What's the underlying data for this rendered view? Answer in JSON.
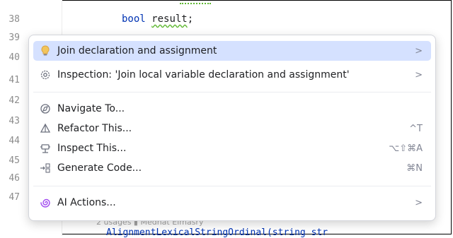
{
  "editor": {
    "line_numbers": [
      "38",
      "39",
      "40",
      "41",
      "42",
      "43",
      "44",
      "45",
      "46",
      "47"
    ],
    "code_line": {
      "keyword": "bool",
      "variable": "result",
      "tail": ";"
    },
    "hint_text": "2 usages  ▮ Medhat Elmasry",
    "bottom_code": "AlignmentLexicalStringOrdinal(string str"
  },
  "popup": {
    "items": [
      {
        "label": "Join declaration and assignment",
        "icon": "lightbulb-icon",
        "submenu": true
      },
      {
        "label": "Inspection: 'Join local variable declaration and assignment'",
        "icon": "inspection-gear-icon",
        "submenu": true
      },
      {
        "label": "Navigate To...",
        "icon": "navigate-icon"
      },
      {
        "label": "Refactor This...",
        "icon": "refactor-icon",
        "shortcut": "^T"
      },
      {
        "label": "Inspect This...",
        "icon": "inspect-icon",
        "shortcut": "⌥⇧⌘A"
      },
      {
        "label": "Generate Code...",
        "icon": "generate-icon",
        "shortcut": "⌘N"
      },
      {
        "label": "AI Actions...",
        "icon": "ai-spiral-icon",
        "submenu": true
      }
    ],
    "chevron": ">"
  },
  "colors": {
    "selection": "#d5e1ff",
    "keyword": "#0033b3",
    "ai_accent": "#a24cf0"
  }
}
